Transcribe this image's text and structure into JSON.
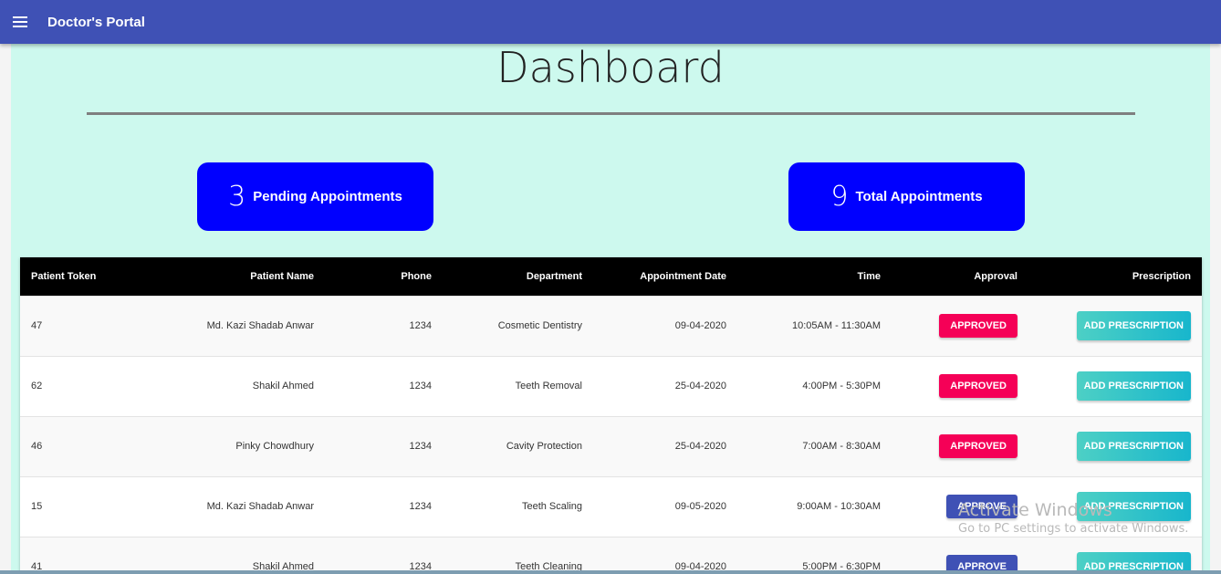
{
  "app": {
    "title": "Doctor's Portal"
  },
  "page": {
    "title": "Dashboard"
  },
  "stats": {
    "pending": {
      "count": "3",
      "label": "Pending Appointments"
    },
    "total": {
      "count": "9",
      "label": "Total Appointments"
    }
  },
  "table": {
    "headers": {
      "token": "Patient Token",
      "name": "Patient Name",
      "phone": "Phone",
      "department": "Department",
      "date": "Appointment Date",
      "time": "Time",
      "approval": "Approval",
      "prescription": "Prescription"
    },
    "rows": [
      {
        "token": "47",
        "name": "Md. Kazi Shadab Anwar",
        "phone": "1234",
        "department": "Cosmetic Dentistry",
        "date": "09-04-2020",
        "time": "10:05AM - 11:30AM",
        "approval": "APPROVED",
        "prescription": "ADD PRESCRIPTION"
      },
      {
        "token": "62",
        "name": "Shakil Ahmed",
        "phone": "1234",
        "department": "Teeth Removal",
        "date": "25-04-2020",
        "time": "4:00PM - 5:30PM",
        "approval": "APPROVED",
        "prescription": "ADD PRESCRIPTION"
      },
      {
        "token": "46",
        "name": "Pinky Chowdhury",
        "phone": "1234",
        "department": "Cavity Protection",
        "date": "25-04-2020",
        "time": "7:00AM - 8:30AM",
        "approval": "APPROVED",
        "prescription": "ADD PRESCRIPTION"
      },
      {
        "token": "15",
        "name": "Md. Kazi Shadab Anwar",
        "phone": "1234",
        "department": "Teeth Scaling",
        "date": "09-05-2020",
        "time": "9:00AM - 10:30AM",
        "approval": "APPROVE",
        "prescription": "ADD PRESCRIPTION"
      },
      {
        "token": "41",
        "name": "Shakil Ahmed",
        "phone": "1234",
        "department": "Teeth Cleaning",
        "date": "09-04-2020",
        "time": "5:00PM - 6:30PM",
        "approval": "APPROVE",
        "prescription": "ADD PRESCRIPTION"
      }
    ]
  },
  "watermark": {
    "line1": "Activate Windows",
    "line2": "Go to PC settings to activate Windows."
  },
  "colors": {
    "appbar": "#3f51b5",
    "background": "#cdf9ee",
    "stat_card": "#0000ff",
    "approved": "#f50057",
    "approve": "#3f51b5",
    "prescription": "#18b6cc"
  },
  "icons": {
    "menu": "hamburger-menu-icon"
  }
}
